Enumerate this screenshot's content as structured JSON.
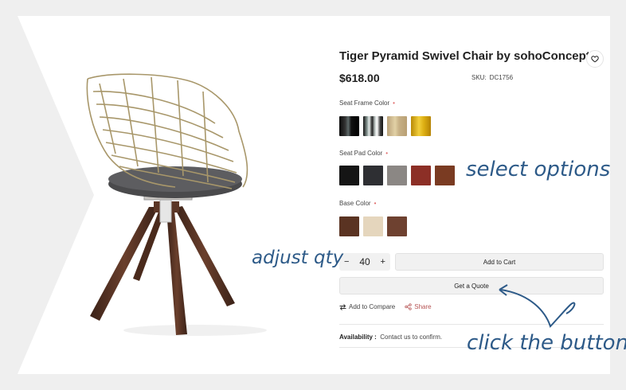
{
  "product": {
    "title": "Tiger Pyramid Swivel Chair by sohoConcept",
    "price": "$618.00",
    "sku_label": "SKU:",
    "sku_value": "DC1756"
  },
  "options": {
    "seat_frame": {
      "label": "Seat Frame Color",
      "swatches": [
        "black-chrome",
        "chrome",
        "champagne",
        "gold"
      ]
    },
    "seat_pad": {
      "label": "Seat Pad Color",
      "swatches": [
        "#151515",
        "#2e2f33",
        "#8b8784",
        "#8c2f26",
        "#7a3b22"
      ]
    },
    "base": {
      "label": "Base Color",
      "swatches": [
        "#5a3322",
        "#e5d6bd",
        "#6e4130"
      ]
    },
    "required_mark": "•"
  },
  "quantity": {
    "minus": "−",
    "value": "40",
    "plus": "+"
  },
  "buttons": {
    "add_to_cart": "Add to Cart",
    "get_quote": "Get a Quote"
  },
  "links": {
    "compare": "Add to Compare",
    "share": "Share"
  },
  "availability": {
    "label": "Availability :",
    "value": "Contact us to confirm."
  },
  "annotations": {
    "select": "select options",
    "qty": "adjust qty",
    "click": "click the button"
  },
  "colors": {
    "annotation": "#2d5a88",
    "share": "#b65353",
    "required": "#e06a6a"
  }
}
